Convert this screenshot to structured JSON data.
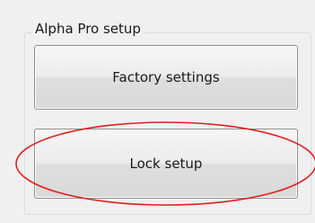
{
  "group": {
    "title": "Alpha Pro setup"
  },
  "buttons": {
    "factory_settings": "Factory settings",
    "lock_setup": "Lock setup"
  },
  "annotation": {
    "color": "#e01f1f"
  },
  "colors": {
    "window_bg": "#f0f0f0",
    "button_border": "#8e8f8f"
  }
}
